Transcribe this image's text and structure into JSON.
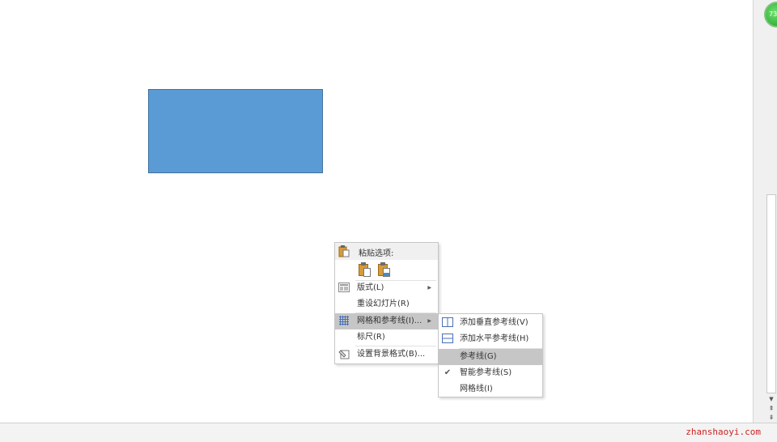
{
  "badge": {
    "text": "73"
  },
  "context_menu": {
    "paste_header": "粘贴选项:",
    "paste_options": [
      "keep-source-formatting",
      "picture"
    ],
    "items": [
      {
        "label": "版式(L)",
        "icon": "layout-icon",
        "has_submenu": true
      },
      {
        "label": "重设幻灯片(R)",
        "icon": "",
        "has_submenu": false
      },
      {
        "label": "网格和参考线(I)...",
        "icon": "grid-icon",
        "has_submenu": true,
        "highlighted": true
      },
      {
        "label": "标尺(R)",
        "icon": "",
        "has_submenu": false
      },
      {
        "label": "设置背景格式(B)...",
        "icon": "format-background-icon",
        "has_submenu": false
      }
    ]
  },
  "submenu": {
    "items": [
      {
        "label": "添加垂直参考线(V)",
        "icon": "vertical-guide-icon"
      },
      {
        "label": "添加水平参考线(H)",
        "icon": "horizontal-guide-icon"
      },
      {
        "label": "参考线(G)",
        "highlighted": true
      },
      {
        "label": "智能参考线(S)",
        "checked": true
      },
      {
        "label": "网格线(I)"
      }
    ]
  },
  "watermark": "zhanshaoyi.com",
  "colors": {
    "shape_fill": "#5b9bd5",
    "highlight": "#c6c6c6"
  }
}
